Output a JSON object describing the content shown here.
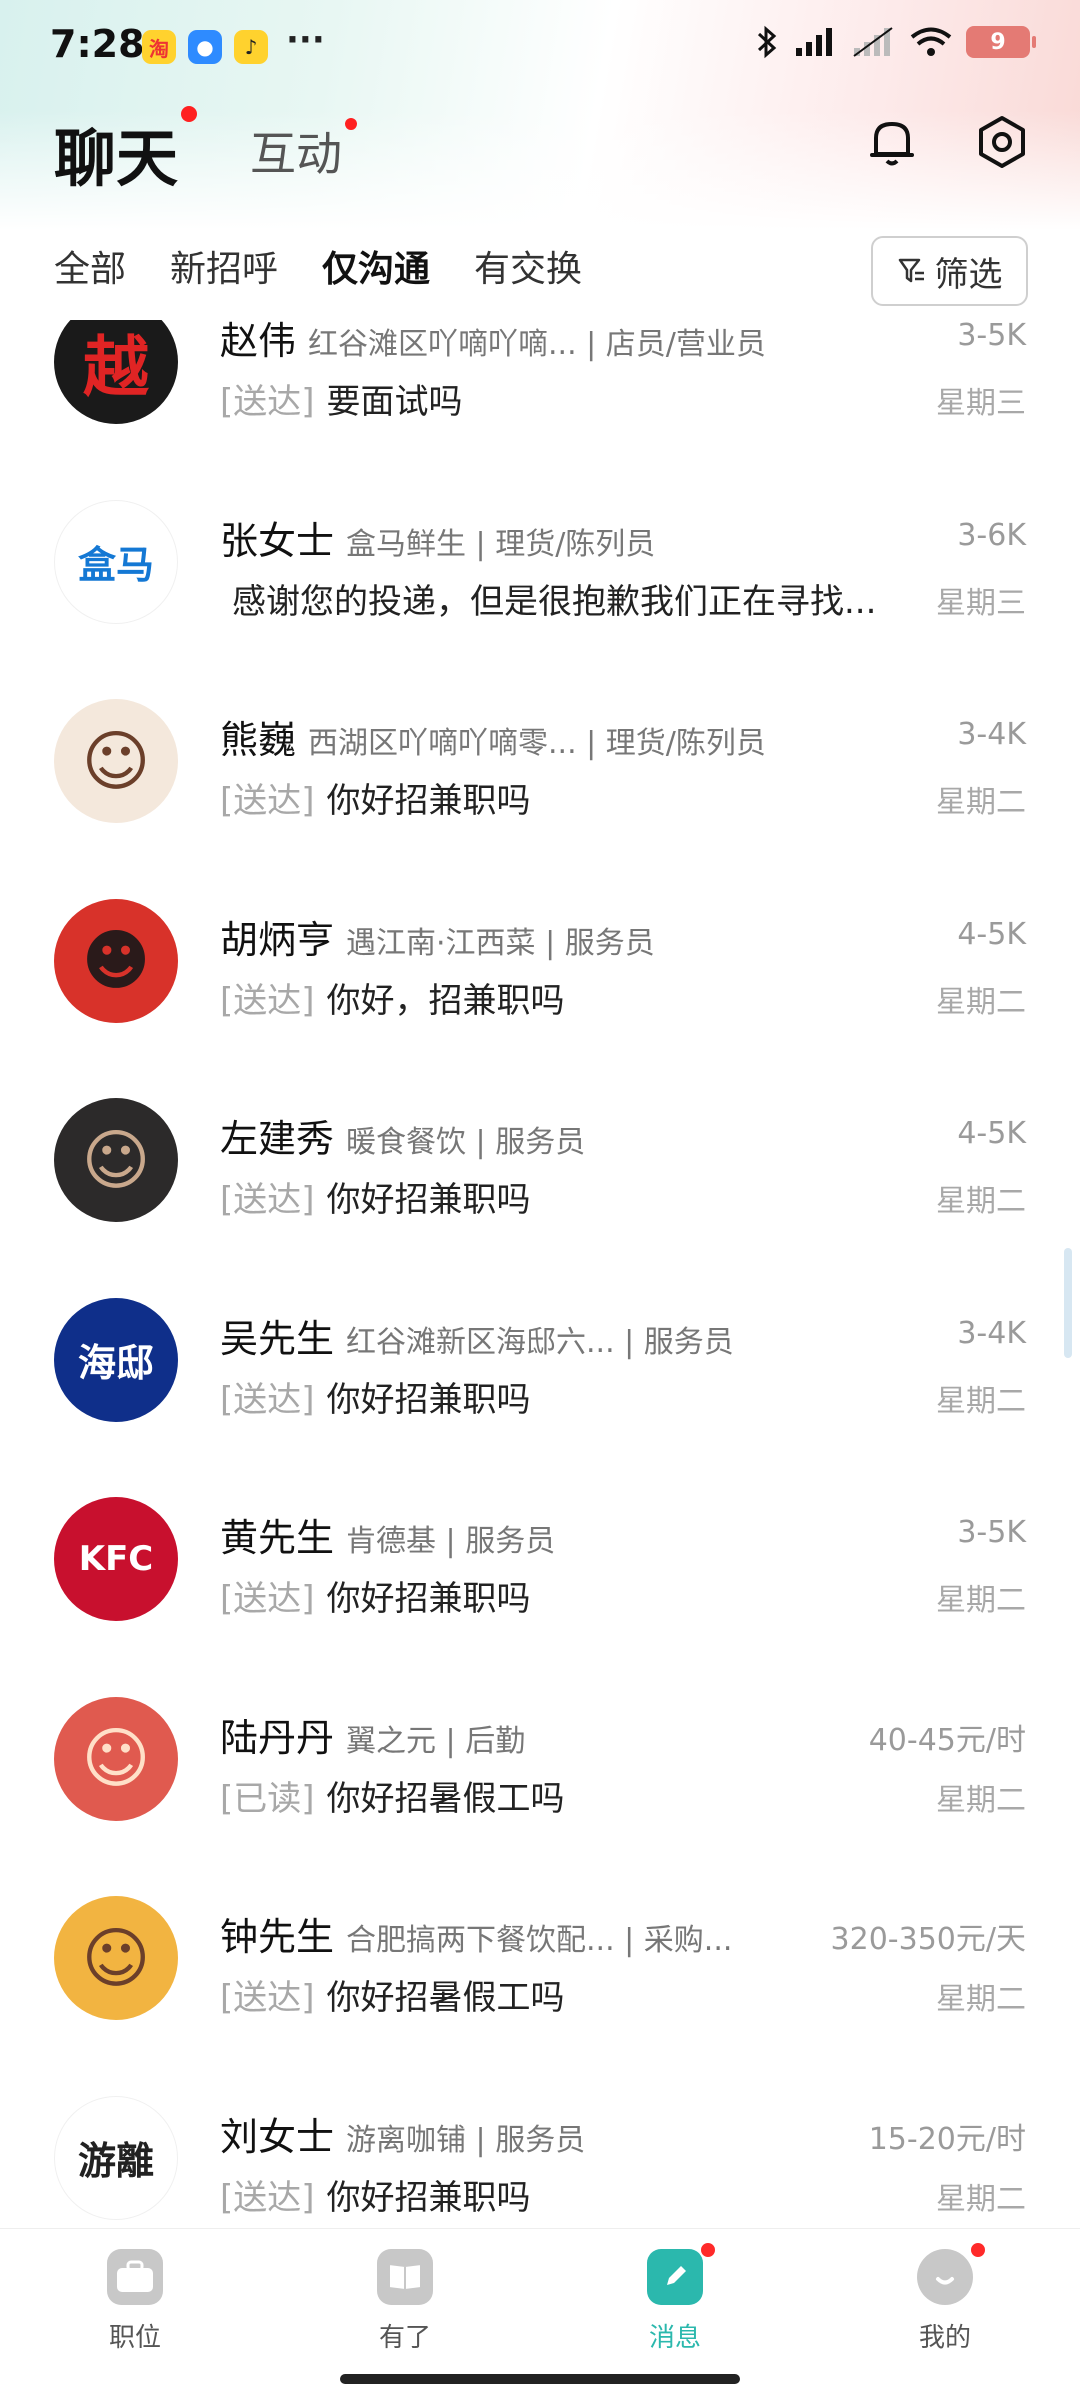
{
  "status_bar": {
    "time": "7:28",
    "app_icons": [
      {
        "name": "taobao-icon",
        "glyph": "淘",
        "bg": "#ffd22e",
        "fg": "#e33"
      },
      {
        "name": "chat-app-icon",
        "glyph": "●",
        "bg": "#2e8bff",
        "fg": "#fff"
      },
      {
        "name": "music-app-icon",
        "glyph": "♪",
        "bg": "#ffd22e",
        "fg": "#222"
      }
    ],
    "more": "···",
    "battery": "9"
  },
  "header": {
    "title": "聊天",
    "subtitle": "互动"
  },
  "tabs": [
    {
      "label": "全部",
      "active": false
    },
    {
      "label": "新招呼",
      "active": false
    },
    {
      "label": "仅沟通",
      "active": true
    },
    {
      "label": "有交换",
      "active": false
    }
  ],
  "filter_label": "筛选",
  "chats": [
    {
      "name": "赵伟",
      "meta": "红谷滩区吖嘀吖嘀... | 店员/营业员",
      "salary": "3-5K",
      "status": "[送达]",
      "message": "要面试吗",
      "date": "星期三",
      "avatar": {
        "glyph": "越",
        "bg": "#1a1a1a",
        "fg": "#e02424"
      }
    },
    {
      "name": "张女士",
      "meta": "盒马鲜生 | 理货/陈列员",
      "salary": "3-6K",
      "status": "",
      "message": "感谢您的投递，但是很抱歉我们正在寻找...",
      "date": "星期三",
      "avatar": {
        "glyph": "盒马",
        "bg": "#ffffff",
        "fg": "#1478d4"
      }
    },
    {
      "name": "熊巍",
      "meta": "西湖区吖嘀吖嘀零... | 理货/陈列员",
      "salary": "3-4K",
      "status": "[送达]",
      "message": "你好招兼职吗",
      "date": "星期二",
      "avatar": {
        "glyph": "☺",
        "bg": "#f4e8dc",
        "fg": "#6b3f2a"
      }
    },
    {
      "name": "胡炳亨",
      "meta": "遇江南·江西菜 | 服务员",
      "salary": "4-5K",
      "status": "[送达]",
      "message": "你好，招兼职吗",
      "date": "星期二",
      "avatar": {
        "glyph": "☻",
        "bg": "#d8322a",
        "fg": "#2a1a1a"
      }
    },
    {
      "name": "左建秀",
      "meta": "暖食餐饮 | 服务员",
      "salary": "4-5K",
      "status": "[送达]",
      "message": "你好招兼职吗",
      "date": "星期二",
      "avatar": {
        "glyph": "☺",
        "bg": "#2c2a2a",
        "fg": "#c9a88c"
      }
    },
    {
      "name": "吴先生",
      "meta": "红谷滩新区海邸六... | 服务员",
      "salary": "3-4K",
      "status": "[送达]",
      "message": "你好招兼职吗",
      "date": "星期二",
      "avatar": {
        "glyph": "海邸",
        "bg": "#0f2f8a",
        "fg": "#ffffff"
      }
    },
    {
      "name": "黄先生",
      "meta": "肯德基 | 服务员",
      "salary": "3-5K",
      "status": "[送达]",
      "message": "你好招兼职吗",
      "date": "星期二",
      "avatar": {
        "glyph": "KFC",
        "bg": "#c8102e",
        "fg": "#ffffff"
      }
    },
    {
      "name": "陆丹丹",
      "meta": "翼之元 | 后勤",
      "salary": "40-45元/时",
      "status": "[已读]",
      "message": "你好招暑假工吗",
      "date": "星期二",
      "avatar": {
        "glyph": "☺",
        "bg": "#e05a4f",
        "fg": "#ffe0c8"
      }
    },
    {
      "name": "钟先生",
      "meta": "合肥搞两下餐饮配... | 采购...",
      "salary": "320-350元/天",
      "status": "[送达]",
      "message": "你好招暑假工吗",
      "date": "星期二",
      "avatar": {
        "glyph": "☺",
        "bg": "#f2b441",
        "fg": "#6b3f2a"
      }
    },
    {
      "name": "刘女士",
      "meta": "游离咖铺 | 服务员",
      "salary": "15-20元/时",
      "status": "[送达]",
      "message": "你好招兼职吗",
      "date": "星期二",
      "avatar": {
        "glyph": "游離",
        "bg": "#ffffff",
        "fg": "#222222"
      }
    }
  ],
  "bottom_nav": [
    {
      "label": "职位",
      "icon": "briefcase-icon",
      "active": false,
      "dot": false
    },
    {
      "label": "有了",
      "icon": "book-icon",
      "active": false,
      "dot": false
    },
    {
      "label": "消息",
      "icon": "message-icon",
      "active": true,
      "dot": true
    },
    {
      "label": "我的",
      "icon": "profile-icon",
      "active": false,
      "dot": true
    }
  ],
  "colors": {
    "accent": "#2bb8ad",
    "badge": "#ff2020"
  }
}
